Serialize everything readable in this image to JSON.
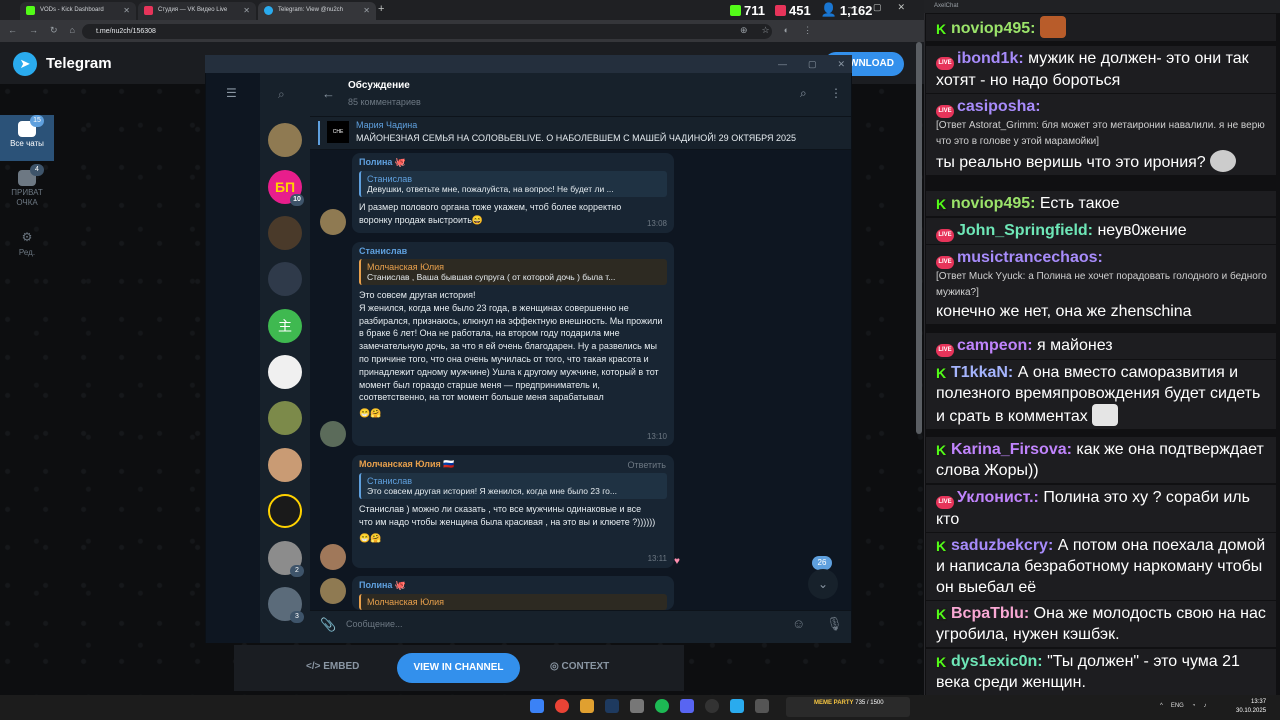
{
  "browser": {
    "tabs": [
      {
        "label": "VODs - Kick Dashboard"
      },
      {
        "label": "Студия — VK Видео Live"
      },
      {
        "label": "Telegram: View @nu2ch"
      }
    ],
    "url": "t.me/nu2ch/156308",
    "counters": [
      {
        "platform": "kick",
        "value": "711"
      },
      {
        "platform": "vk-live",
        "value": "451"
      },
      {
        "platform": "viewers",
        "value": "1,162"
      }
    ]
  },
  "telegram_web": {
    "title": "Telegram",
    "download_label": "DOWNLOAD",
    "bottom": {
      "embed": "EMBED",
      "view_channel": "VIEW IN CHANNEL",
      "context": "CONTEXT"
    }
  },
  "desktop": {
    "folders": [
      {
        "label": "Все чаты",
        "badge": "15"
      },
      {
        "label": "ПРИВАТ ОЧКА",
        "badge": "4"
      },
      {
        "label": "Ред.",
        "badge": ""
      }
    ],
    "chat_badges": [
      "10",
      "2",
      "3"
    ],
    "header": {
      "title": "Обсуждение",
      "subtitle": "85 комментариев"
    },
    "pinned": {
      "name": "Мария Чадина",
      "text": "МАЙОНЕЗНАЯ СЕМЬЯ НА СОЛОВЬЕВLIVE. О НАБОЛЕВШЕМ С МАШЕЙ ЧАДИНОЙ! 29 ОКТЯБРЯ 2025",
      "thumb": "CHE"
    },
    "messages": [
      {
        "sender": "Полина 🐙",
        "quote_name": "Станислав",
        "quote_text": "Девушки, ответьте мне, пожалуйста, на вопрос! Не будет ли ...",
        "text": "И размер полового органа тоже укажем, чтоб более корректно воронку продаж выстроить😄",
        "time": "13:08"
      },
      {
        "sender": "Станислав",
        "quote_name": "Молчанская Юлия",
        "quote_text": "Станислав , Ваша бывшая супруга ( от которой дочь ) была т...",
        "text": "Это совсем другая история!\nЯ женился, когда мне было 23 года, в женщинах совершенно не разбирался, признаюсь, клюнул на эффектную внешность. Мы прожили в браке 6 лет! Она не работала, на втором году подарила мне замечательную дочь, за что я ей очень благодарен. Ну а развелись мы по причине того, что она очень мучилась от того, что такая красота и принадлежит одному мужчине) Ушла к другому мужчине, который в тот момент был гораздо старше меня — предприниматель и, соответственно, на тот момент больше меня зарабатывал",
        "reacts": "😁🤗",
        "time": "13:10"
      },
      {
        "sender": "Молчанская Юлия 🇷🇺",
        "reply": "Ответить",
        "quote_name": "Станислав",
        "quote_text": "Это совсем другая история! Я женился, когда мне было 23 го...",
        "text": "Станислав ) можно ли сказать , что все мужчины одинаковые и все что им надо чтобы женщина была красивая , на это вы и клюете ?))))))",
        "reacts": "😁🤗",
        "time": "13:11"
      },
      {
        "sender": "Полина 🐙",
        "quote_name": "Молчанская Юлия",
        "quote_text": "",
        "text": "",
        "time": ""
      }
    ],
    "unread_count": "26",
    "composer_placeholder": "Сообщение..."
  },
  "chat_panel": {
    "title": "AxelChat",
    "messages": [
      {
        "platform": "kick",
        "user": "noviop495:",
        "user_color": "#9be36a",
        "text": ""
      },
      {
        "platform": "live",
        "user": "ibond1k:",
        "user_color": "#a78bfa",
        "text": "мужик не должен- это они так хотят - но надо бороться"
      },
      {
        "platform": "live",
        "user": "casiposha:",
        "user_color": "#a78bfa",
        "small": "[Ответ Astorat_Grimm: бля может это метаиронии навалили. я не верю что это в голове у этой марамойки]",
        "text": "ты реально веришь что это ирония?"
      },
      {
        "platform": "kick",
        "user": "noviop495:",
        "user_color": "#9be36a",
        "text": "Есть такое"
      },
      {
        "platform": "live",
        "user": "John_Springfield:",
        "user_color": "#6ee7b7",
        "text": "неув0жение"
      },
      {
        "platform": "live",
        "user": "musictrancechaos:",
        "user_color": "#a78bfa",
        "small": "[Ответ Muck Yyuck: а Полина не хочет порадовать голодного и бедного мужика?]",
        "text": "конечно же нет, она же zhenschina"
      },
      {
        "platform": "live",
        "user": "campeon:",
        "user_color": "#c084fc",
        "text": "я майонез"
      },
      {
        "platform": "kick",
        "user": "T1kkaN:",
        "user_color": "#a5b4fc",
        "text": "А она вместо саморазвития и полезного времяпровождения будет сидеть и срать в комментах"
      },
      {
        "platform": "kick",
        "user": "Karina_Firsova:",
        "user_color": "#c084fc",
        "text": "как же она подтверждает слова Жоры))"
      },
      {
        "platform": "live",
        "user": "Уклонист.:",
        "user_color": "#c084fc",
        "text": "Полина это ху ? сораби иль кто"
      },
      {
        "platform": "kick",
        "user": "saduzbekcry:",
        "user_color": "#a78bfa",
        "text": "А потом она поехала домой и написала безработному наркоману чтобы он выебал её"
      },
      {
        "platform": "kick",
        "user": "BcpaTblu:",
        "user_color": "#f9a8d4",
        "text": "Она же молодость свою на нас угробила, нужен кэшбэк."
      },
      {
        "platform": "kick",
        "user": "dys1exic0n:",
        "user_color": "#6ee7b7",
        "text": "\"Ты должен\" - это чума 21 века среди женщин."
      }
    ]
  },
  "taskbar": {
    "meme_label": "MEME PARTY",
    "meme_progress": "735 / 1500",
    "lang": "ENG",
    "time": "13:37",
    "date": "30.10.2025"
  }
}
